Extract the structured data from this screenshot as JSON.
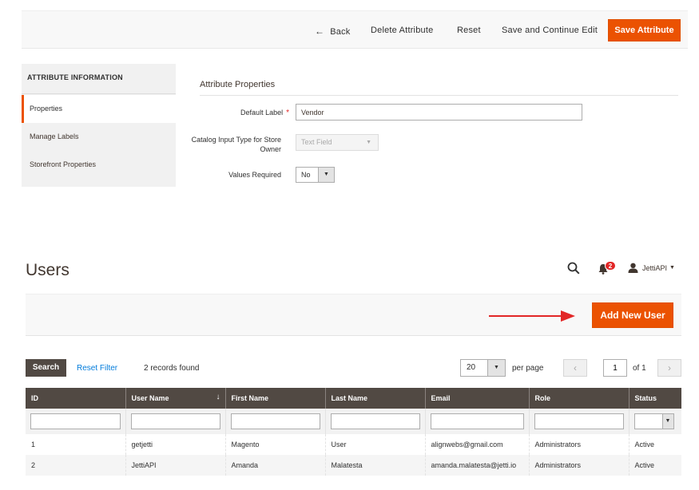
{
  "attribute_page": {
    "actions": {
      "back": "Back",
      "delete": "Delete Attribute",
      "reset": "Reset",
      "save_continue": "Save and Continue Edit",
      "save": "Save Attribute"
    },
    "side_nav": {
      "title": "ATTRIBUTE INFORMATION",
      "items": [
        "Properties",
        "Manage Labels",
        "Storefront Properties"
      ],
      "active": "Properties"
    },
    "section_title": "Attribute Properties",
    "fields": {
      "default_label": {
        "label": "Default Label",
        "required_mark": "*",
        "value": "Vendor"
      },
      "input_type": {
        "label": "Catalog Input Type for Store Owner",
        "value": "Text Field",
        "disabled": true
      },
      "values_required": {
        "label": "Values Required",
        "value": "No"
      }
    }
  },
  "users_page": {
    "title": "Users",
    "header": {
      "notifications_count": "2",
      "username": "JettiAPI"
    },
    "add_button": "Add New User",
    "toolbar": {
      "search": "Search",
      "reset_filter": "Reset Filter",
      "records_found": "2 records found",
      "per_page_value": "20",
      "per_page_label": "per page",
      "current_page": "1",
      "of_pages": "of 1"
    },
    "table": {
      "columns": [
        "ID",
        "User Name",
        "First Name",
        "Last Name",
        "Email",
        "Role",
        "Status"
      ],
      "sorted_column": "User Name",
      "rows": [
        [
          "1",
          "getjetti",
          "Magento",
          "User",
          "alignwebs@gmail.com",
          "Administrators",
          "Active"
        ],
        [
          "2",
          "JettiAPI",
          "Amanda",
          "Malatesta",
          "amanda.malatesta@jetti.io",
          "Administrators",
          "Active"
        ]
      ]
    },
    "colors": {
      "accent": "#eb5202",
      "header_dark": "#514943",
      "link": "#007bdb",
      "arrow": "#e22626"
    }
  }
}
